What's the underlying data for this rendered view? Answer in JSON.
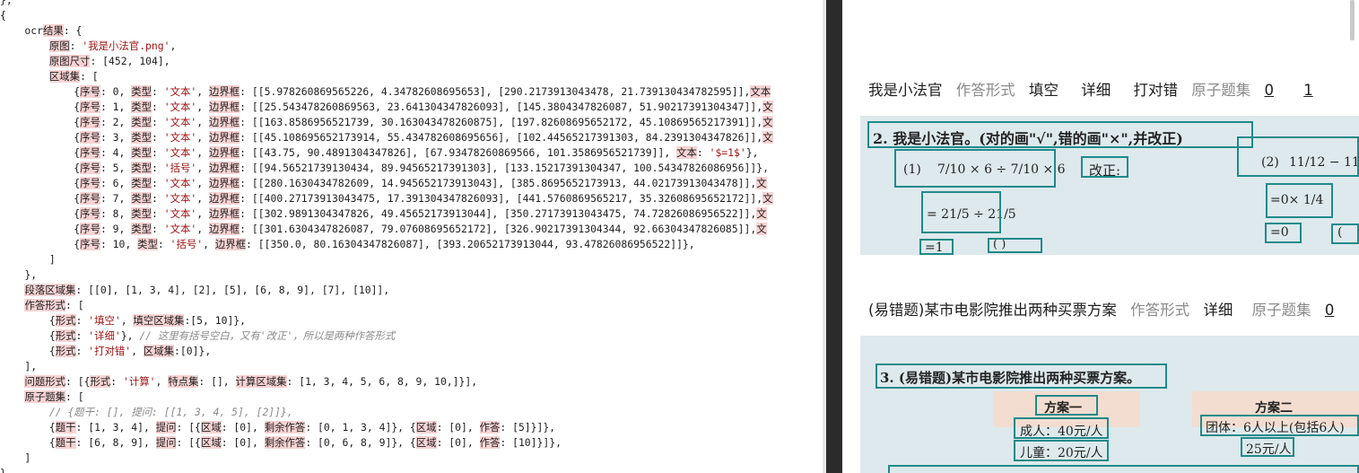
{
  "editor": {
    "lines": [
      [
        [
          "},",
          ""
        ]
      ],
      [
        [
          "{",
          ""
        ]
      ],
      [
        [
          "    ocr",
          ""
        ],
        [
          "结果",
          "hl"
        ],
        [
          ": {",
          ""
        ]
      ],
      [
        [
          "        ",
          ""
        ],
        [
          "原图",
          "hl"
        ],
        [
          ": ",
          ""
        ],
        [
          "'我是小法官.png'",
          "str"
        ],
        [
          ",",
          ""
        ]
      ],
      [
        [
          "        ",
          ""
        ],
        [
          "原图尺寸",
          "hl"
        ],
        [
          ": [452, 104],",
          ""
        ]
      ],
      [
        [
          "        ",
          ""
        ],
        [
          "区域集",
          "hl"
        ],
        [
          ": [",
          ""
        ]
      ],
      [
        [
          "            {",
          ""
        ],
        [
          "序号",
          "hl"
        ],
        [
          ": 0, ",
          ""
        ],
        [
          "类型",
          "hl"
        ],
        [
          ": ",
          ""
        ],
        [
          "'文本'",
          "str"
        ],
        [
          ", ",
          ""
        ],
        [
          "边界框",
          "hl"
        ],
        [
          ": [[5.978260869565226, 4.34782608695653], [290.2173913043478, 21.739130434782595]],",
          ""
        ],
        [
          "文本",
          "hl"
        ]
      ],
      [
        [
          "            {",
          ""
        ],
        [
          "序号",
          "hl"
        ],
        [
          ": 1, ",
          ""
        ],
        [
          "类型",
          "hl"
        ],
        [
          ": ",
          ""
        ],
        [
          "'文本'",
          "str"
        ],
        [
          ", ",
          ""
        ],
        [
          "边界框",
          "hl"
        ],
        [
          ": [[25.543478260869563, 23.641304347826093], [145.3804347826087, 51.90217391304347]],",
          ""
        ],
        [
          "文",
          "hl"
        ]
      ],
      [
        [
          "            {",
          ""
        ],
        [
          "序号",
          "hl"
        ],
        [
          ": 2, ",
          ""
        ],
        [
          "类型",
          "hl"
        ],
        [
          ": ",
          ""
        ],
        [
          "'文本'",
          "str"
        ],
        [
          ", ",
          ""
        ],
        [
          "边界框",
          "hl"
        ],
        [
          ": [[163.8586956521739, 30.163043478260875], [197.82608695652172, 45.10869565217391]],",
          ""
        ],
        [
          "文",
          "hl"
        ]
      ],
      [
        [
          "            {",
          ""
        ],
        [
          "序号",
          "hl"
        ],
        [
          ": 3, ",
          ""
        ],
        [
          "类型",
          "hl"
        ],
        [
          ": ",
          ""
        ],
        [
          "'文本'",
          "str"
        ],
        [
          ", ",
          ""
        ],
        [
          "边界框",
          "hl"
        ],
        [
          ": [[45.108695652173914, 55.434782608695656], [102.44565217391303, 84.2391304347826]],",
          ""
        ],
        [
          "文",
          "hl"
        ]
      ],
      [
        [
          "            {",
          ""
        ],
        [
          "序号",
          "hl"
        ],
        [
          ": 4, ",
          ""
        ],
        [
          "类型",
          "hl"
        ],
        [
          ": ",
          ""
        ],
        [
          "'文本'",
          "str"
        ],
        [
          ", ",
          ""
        ],
        [
          "边界框",
          "hl"
        ],
        [
          ": [[43.75, 90.4891304347826], [67.93478260869566, 101.3586956521739]], ",
          ""
        ],
        [
          "文本",
          "hl"
        ],
        [
          ": ",
          ""
        ],
        [
          "'$=1$'",
          "str"
        ],
        [
          "},",
          ""
        ]
      ],
      [
        [
          "            {",
          ""
        ],
        [
          "序号",
          "hl"
        ],
        [
          ": 5, ",
          ""
        ],
        [
          "类型",
          "hl"
        ],
        [
          ": ",
          ""
        ],
        [
          "'括号'",
          "str"
        ],
        [
          ", ",
          ""
        ],
        [
          "边界框",
          "hl"
        ],
        [
          ": [[94.56521739130434, 89.94565217391303], [133.15217391304347, 100.54347826086956]]},",
          ""
        ]
      ],
      [
        [
          "            {",
          ""
        ],
        [
          "序号",
          "hl"
        ],
        [
          ": 6, ",
          ""
        ],
        [
          "类型",
          "hl"
        ],
        [
          ": ",
          ""
        ],
        [
          "'文本'",
          "str"
        ],
        [
          ", ",
          ""
        ],
        [
          "边界框",
          "hl"
        ],
        [
          ": [[280.1630434782609, 14.945652173913043], [385.8695652173913, 44.02173913043478]],",
          ""
        ],
        [
          "文",
          "hl"
        ]
      ],
      [
        [
          "            {",
          ""
        ],
        [
          "序号",
          "hl"
        ],
        [
          ": 7, ",
          ""
        ],
        [
          "类型",
          "hl"
        ],
        [
          ": ",
          ""
        ],
        [
          "'文本'",
          "str"
        ],
        [
          ", ",
          ""
        ],
        [
          "边界框",
          "hl"
        ],
        [
          ": [[400.27173913043475, 17.391304347826093], [441.5760869565217, 35.32608695652172]],",
          ""
        ],
        [
          "文",
          "hl"
        ]
      ],
      [
        [
          "            {",
          ""
        ],
        [
          "序号",
          "hl"
        ],
        [
          ": 8, ",
          ""
        ],
        [
          "类型",
          "hl"
        ],
        [
          ": ",
          ""
        ],
        [
          "'文本'",
          "str"
        ],
        [
          ", ",
          ""
        ],
        [
          "边界框",
          "hl"
        ],
        [
          ": [[302.9891304347826, 49.45652173913044], [350.27173913043475, 74.72826086956522]],",
          ""
        ],
        [
          "文",
          "hl"
        ]
      ],
      [
        [
          "            {",
          ""
        ],
        [
          "序号",
          "hl"
        ],
        [
          ": 9, ",
          ""
        ],
        [
          "类型",
          "hl"
        ],
        [
          ": ",
          ""
        ],
        [
          "'文本'",
          "str"
        ],
        [
          ", ",
          ""
        ],
        [
          "边界框",
          "hl"
        ],
        [
          ": [[301.6304347826087, 79.07608695652172], [326.90217391304344, 92.66304347826085]],",
          ""
        ],
        [
          "文",
          "hl"
        ]
      ],
      [
        [
          "            {",
          ""
        ],
        [
          "序号",
          "hl"
        ],
        [
          ": 10, ",
          ""
        ],
        [
          "类型",
          "hl"
        ],
        [
          ": ",
          ""
        ],
        [
          "'括号'",
          "str"
        ],
        [
          ", ",
          ""
        ],
        [
          "边界框",
          "hl"
        ],
        [
          ": [[350.0, 80.16304347826087], [393.20652173913044, 93.47826086956522]]},",
          ""
        ]
      ],
      [
        [
          "        ]",
          ""
        ]
      ],
      [
        [
          "    },",
          ""
        ]
      ],
      [
        [
          "    ",
          ""
        ],
        [
          "段落区域集",
          "hl"
        ],
        [
          ": [[0], [1, 3, 4], [2], [5], [6, 8, 9], [7], [10]],",
          ""
        ]
      ],
      [
        [
          "    ",
          ""
        ],
        [
          "作答形式",
          "hl"
        ],
        [
          ": [",
          ""
        ]
      ],
      [
        [
          "        {",
          ""
        ],
        [
          "形式",
          "hl"
        ],
        [
          ": ",
          ""
        ],
        [
          "'填空'",
          "str"
        ],
        [
          ", ",
          ""
        ],
        [
          "填空区域集",
          "hl"
        ],
        [
          ":[5, 10]},",
          ""
        ]
      ],
      [
        [
          "        {",
          ""
        ],
        [
          "形式",
          "hl"
        ],
        [
          ": ",
          ""
        ],
        [
          "'详细'",
          "str"
        ],
        [
          "}, ",
          ""
        ],
        [
          "// 这里有括号空白，又有'改正'，所以是两种作答形式",
          "cmt"
        ]
      ],
      [
        [
          "        {",
          ""
        ],
        [
          "形式",
          "hl"
        ],
        [
          ": ",
          ""
        ],
        [
          "'打对错'",
          "str"
        ],
        [
          ", ",
          ""
        ],
        [
          "区域集",
          "hl"
        ],
        [
          ":[0]},",
          ""
        ]
      ],
      [
        [
          "    ],",
          ""
        ]
      ],
      [
        [
          "    ",
          ""
        ],
        [
          "问题形式",
          "hl"
        ],
        [
          ": [{",
          ""
        ],
        [
          "形式",
          "hl"
        ],
        [
          ": ",
          ""
        ],
        [
          "'计算'",
          "str"
        ],
        [
          ", ",
          ""
        ],
        [
          "特点集",
          "hl"
        ],
        [
          ": [], ",
          ""
        ],
        [
          "计算区域集",
          "hl"
        ],
        [
          ": [1, 3, 4, 5, 6, 8, 9, 10,]}],",
          ""
        ]
      ],
      [
        [
          "    ",
          ""
        ],
        [
          "原子题集",
          "hl"
        ],
        [
          ": [",
          ""
        ]
      ],
      [
        [
          "        ",
          ""
        ],
        [
          "// {题干: [], 提问: [[1, 3, 4, 5], [2]]},",
          "cmt"
        ]
      ],
      [
        [
          "        {",
          ""
        ],
        [
          "题干",
          "hl"
        ],
        [
          ": [1, 3, 4], ",
          ""
        ],
        [
          "提问",
          "hl"
        ],
        [
          ": [{",
          ""
        ],
        [
          "区域",
          "hl"
        ],
        [
          ": [0], ",
          ""
        ],
        [
          "剩余作答",
          "hl"
        ],
        [
          ": [0, 1, 3, 4]}, {",
          ""
        ],
        [
          "区域",
          "hl"
        ],
        [
          ": [0], ",
          ""
        ],
        [
          "作答",
          "hl"
        ],
        [
          ": [5]}]},",
          ""
        ]
      ],
      [
        [
          "        {",
          ""
        ],
        [
          "题干",
          "hl"
        ],
        [
          ": [6, 8, 9], ",
          ""
        ],
        [
          "提问",
          "hl"
        ],
        [
          ": [{",
          ""
        ],
        [
          "区域",
          "hl"
        ],
        [
          ": [0], ",
          ""
        ],
        [
          "剩余作答",
          "hl"
        ],
        [
          ": [0, 6, 8, 9]}, {",
          ""
        ],
        [
          "区域",
          "hl"
        ],
        [
          ": [0], ",
          ""
        ],
        [
          "作答",
          "hl"
        ],
        [
          ": [10]}]},",
          ""
        ]
      ],
      [
        [
          "    ]",
          ""
        ]
      ],
      [
        [
          "}",
          ""
        ]
      ]
    ]
  },
  "viewer": {
    "q1": {
      "title": "我是小法官",
      "answer_label": "作答形式",
      "forms": [
        "填空",
        "详细",
        "打对错"
      ],
      "atom_label": "原子题集",
      "atom_links": [
        "0",
        "1"
      ],
      "photo": {
        "heading": "2. 我是小法官。(对的画\"√\",错的画\"×\",并改正)",
        "expr1_prefix": "(1)",
        "expr1": "7/10 × 6 ÷ 7/10 × 6",
        "correct": "改正:",
        "expr2_prefix": "(2)",
        "expr2": "11/12 − 11/12 ×",
        "line3": "= 21/5 ÷ 21/5",
        "line4": "=0× 1/4",
        "eq1": "=1",
        "paren": "(      )",
        "eq0": "=0",
        "paren2": "("
      }
    },
    "q2": {
      "title": "(易错题)某市电影院推出两种买票方案",
      "answer_label": "作答形式",
      "forms": [
        "详细"
      ],
      "atom_label": "原子题集",
      "atom_links": [
        "0"
      ],
      "photo": {
        "heading": "3. (易错题)某市电影院推出两种买票方案。",
        "plan1": "方案一",
        "plan1_adult": "成人：40元/人",
        "plan1_child": "儿童：20元/人",
        "plan2": "方案二",
        "plan2_group": "团体：6人以上(包括6人)",
        "plan2_price": "25元/人"
      }
    }
  }
}
